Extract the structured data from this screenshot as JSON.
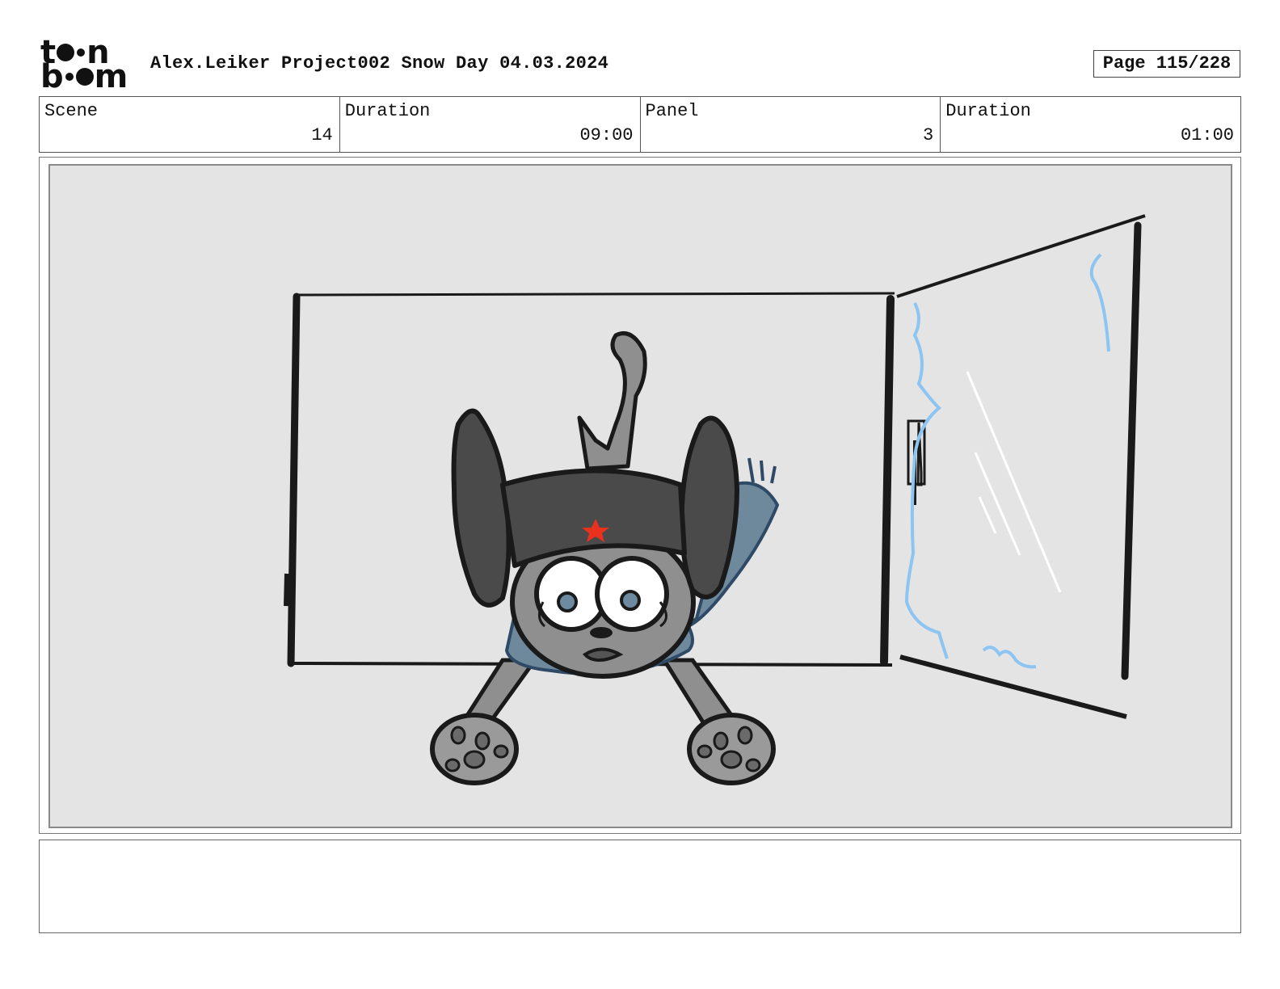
{
  "header": {
    "logo_text": "toon boom",
    "title": "Alex.Leiker Project002 Snow Day 04.03.2024",
    "page": "Page 115/228"
  },
  "info": {
    "scene_label": "Scene",
    "scene_value": "14",
    "scene_duration_label": "Duration",
    "scene_duration_value": "09:00",
    "panel_label": "Panel",
    "panel_value": "3",
    "panel_duration_label": "Duration",
    "panel_duration_value": "01:00"
  },
  "notes": {
    "text": ""
  },
  "colors": {
    "panel_background": "#e4e4e4",
    "star": "#e8321e",
    "frost": "#8cc4f2",
    "hat": "#4a4a4a",
    "scarf": "#6e889c",
    "fur": "#8f8f8f"
  }
}
